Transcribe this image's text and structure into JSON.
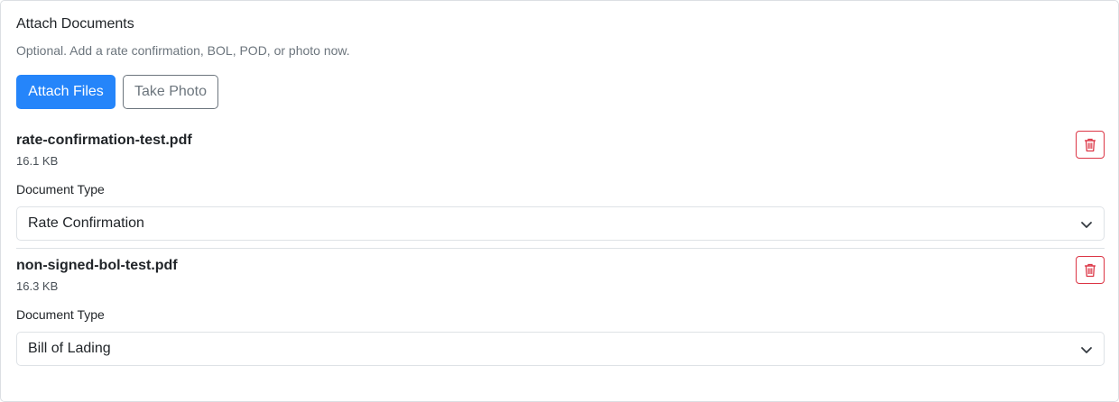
{
  "section": {
    "title": "Attach Documents",
    "subtitle": "Optional. Add a rate confirmation, BOL, POD, or photo now."
  },
  "buttons": {
    "attach": "Attach Files",
    "photo": "Take Photo"
  },
  "files": [
    {
      "name": "rate-confirmation-test.pdf",
      "size": "16.1 KB",
      "type_label": "Document Type",
      "type_value": "Rate Confirmation"
    },
    {
      "name": "non-signed-bol-test.pdf",
      "size": "16.3 KB",
      "type_label": "Document Type",
      "type_value": "Bill of Lading"
    }
  ],
  "icons": {
    "delete": "trash-icon",
    "select": "chevron-down-icon"
  },
  "colors": {
    "primary": "#2585fa",
    "danger": "#dc3545",
    "muted": "#6c757d"
  }
}
